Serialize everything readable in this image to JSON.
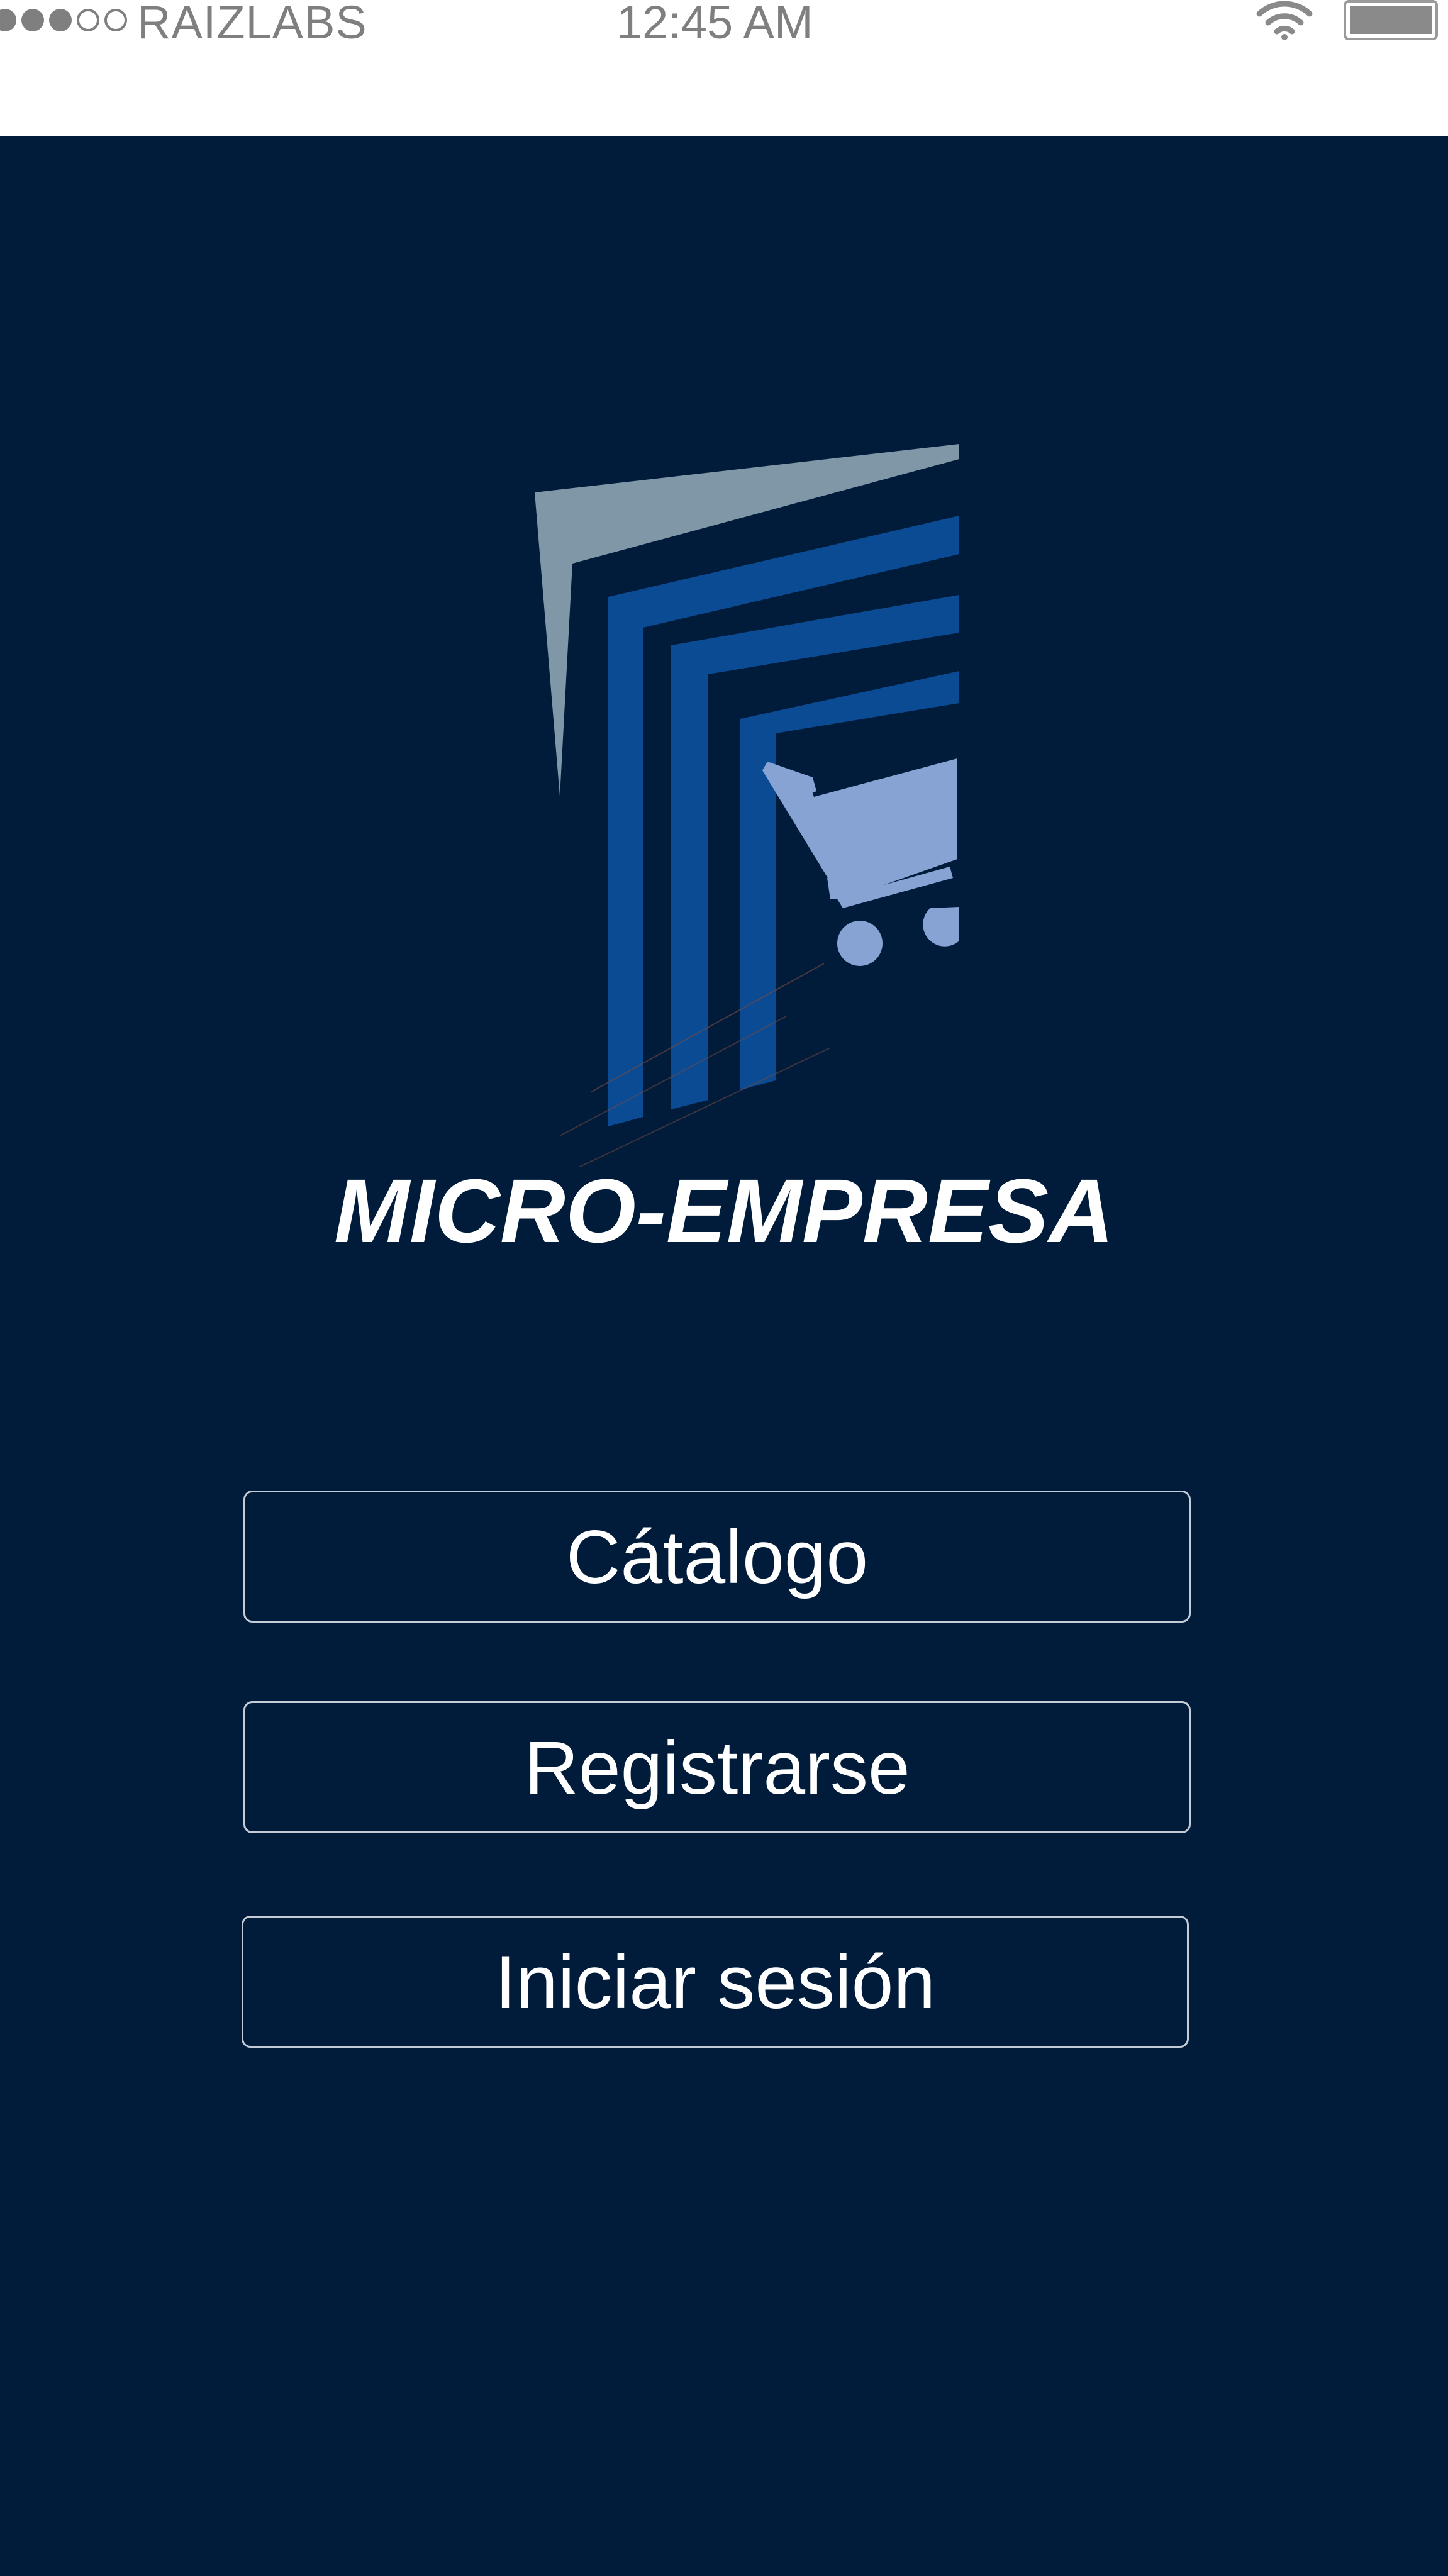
{
  "status_bar": {
    "signal_bars": [
      "full",
      "full",
      "full",
      "empty",
      "empty"
    ],
    "carrier": "RAIZLABS",
    "time": "12:45 AM",
    "wifi_icon": "wifi-icon",
    "battery_icon": "battery-icon"
  },
  "app": {
    "logo_icon": "shopping-cart-logo-icon",
    "title": "MICRO-EMPRESA"
  },
  "menu": {
    "catalog_label": "Cátalogo",
    "register_label": "Registrarse",
    "login_label": "Iniciar sesión"
  },
  "colors": {
    "background": "#011c3b",
    "logo_light": "#7f97a6",
    "logo_blue": "#0a4b93",
    "cart": "#86a3d4",
    "button_border": "#c5cbd6",
    "status_text": "#7f7f7f"
  }
}
